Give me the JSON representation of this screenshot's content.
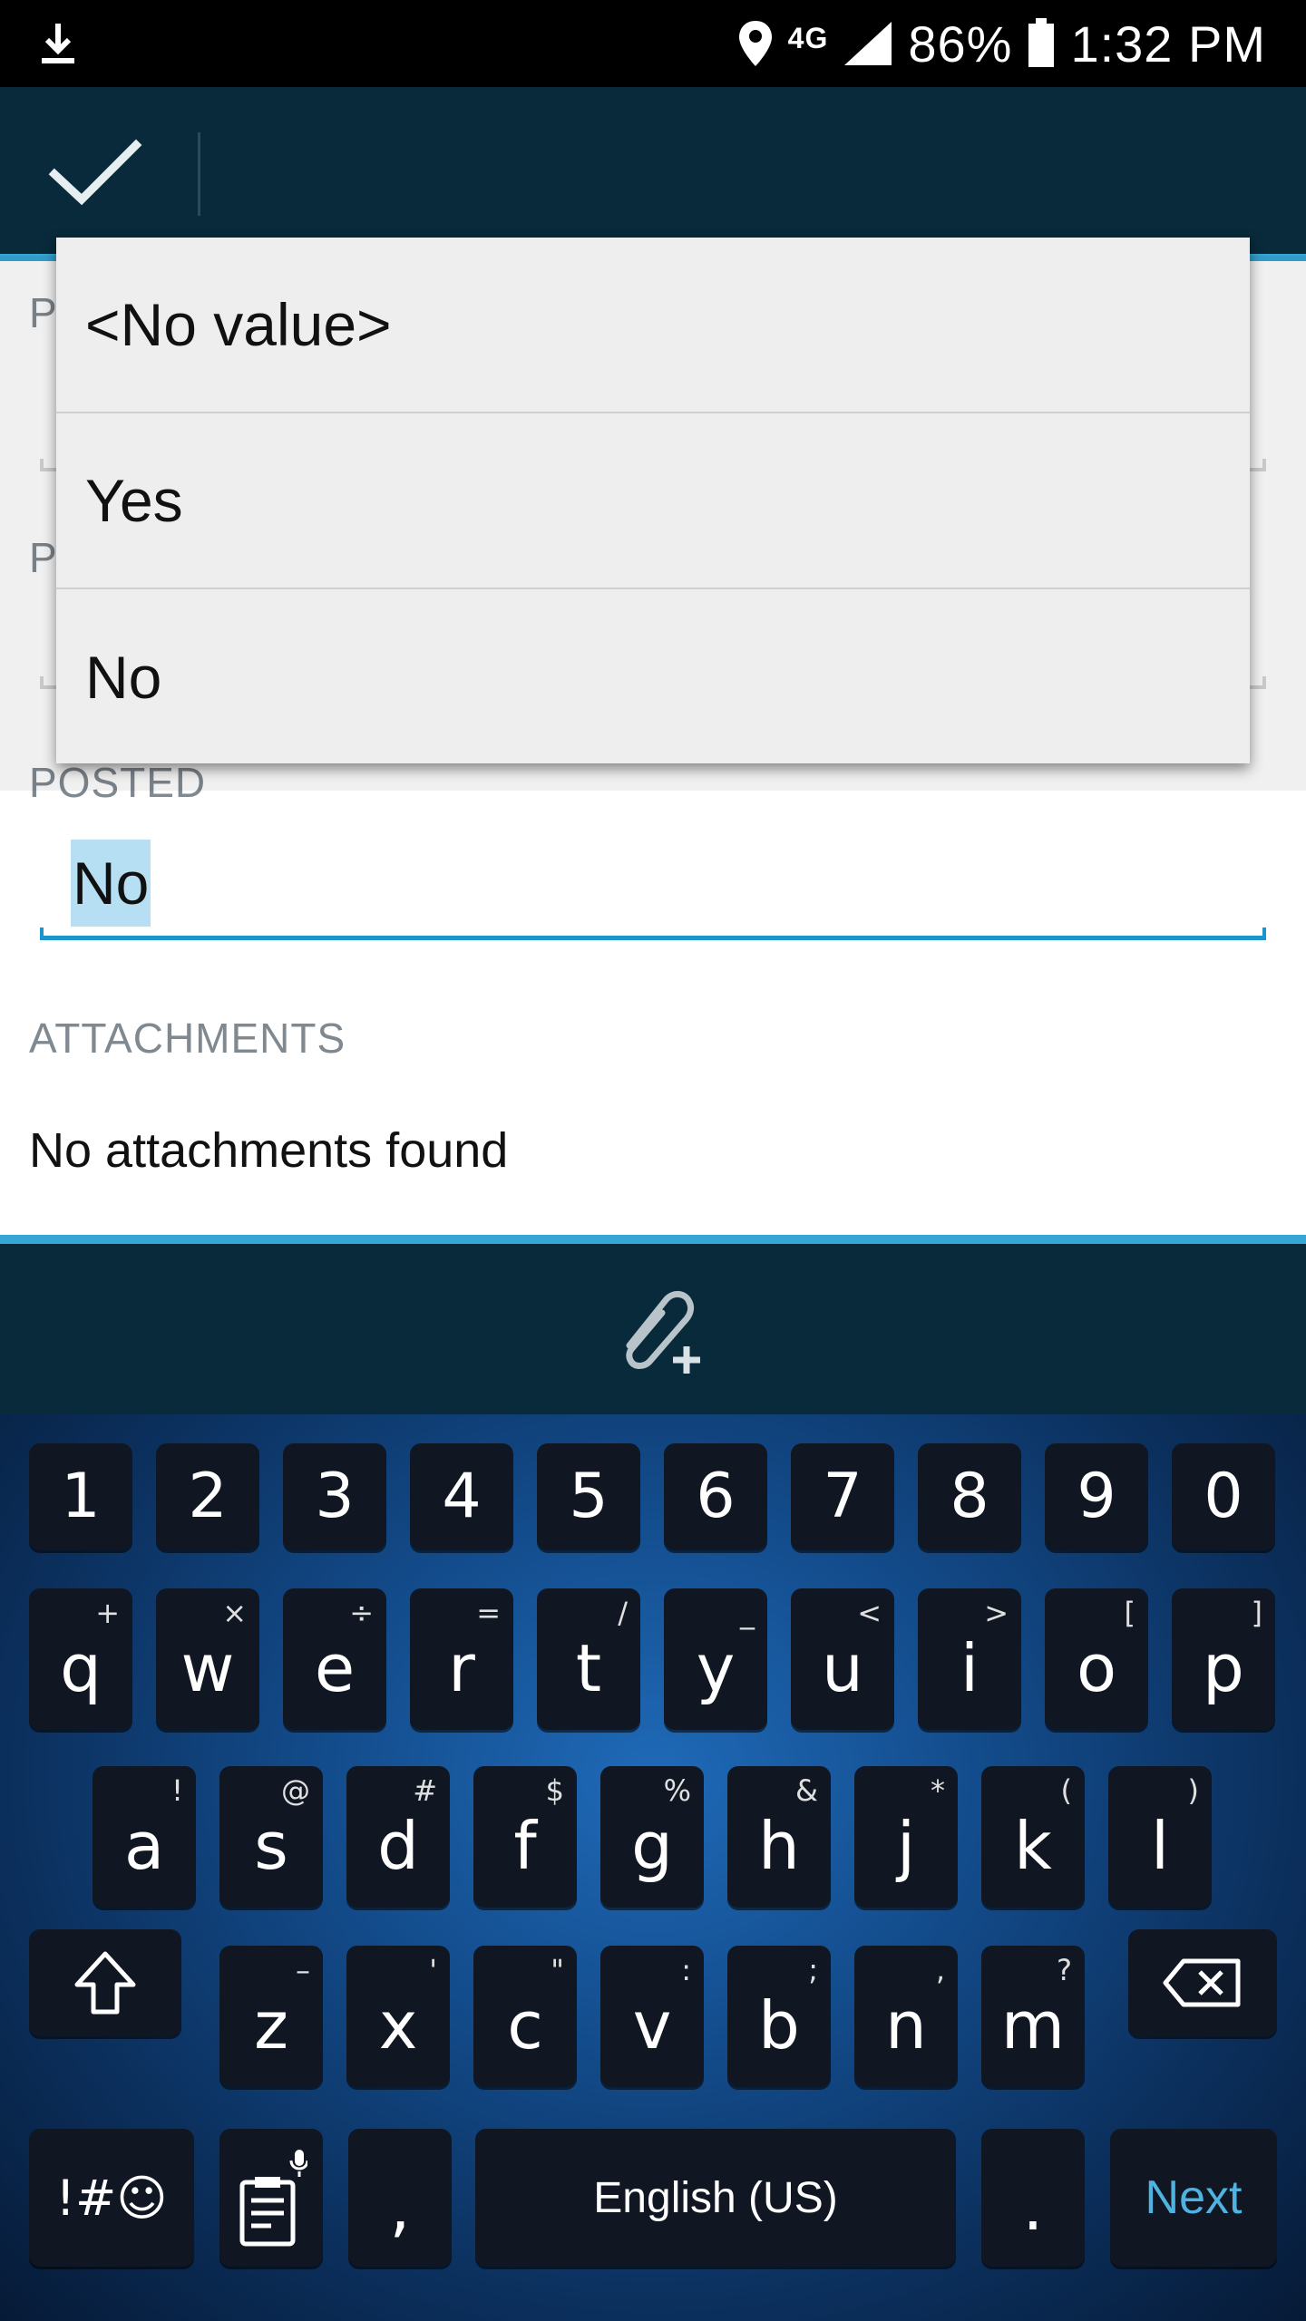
{
  "status_bar": {
    "network": "4G",
    "battery": "86%",
    "time": "1:32 PM"
  },
  "form": {
    "field1_label": "P",
    "field2_label": "P",
    "posted_label": "POSTED",
    "posted_value": "No",
    "attachments_label": "ATTACHMENTS",
    "attachments_empty": "No attachments found"
  },
  "dropdown": {
    "options": [
      "<No value>",
      "Yes",
      "No"
    ]
  },
  "keyboard": {
    "number_row": [
      "1",
      "2",
      "3",
      "4",
      "5",
      "6",
      "7",
      "8",
      "9",
      "0"
    ],
    "row1": [
      {
        "key": "q",
        "alt": "+"
      },
      {
        "key": "w",
        "alt": "×"
      },
      {
        "key": "e",
        "alt": "÷"
      },
      {
        "key": "r",
        "alt": "="
      },
      {
        "key": "t",
        "alt": "/"
      },
      {
        "key": "y",
        "alt": "_"
      },
      {
        "key": "u",
        "alt": "<"
      },
      {
        "key": "i",
        "alt": ">"
      },
      {
        "key": "o",
        "alt": "["
      },
      {
        "key": "p",
        "alt": "]"
      }
    ],
    "row2": [
      {
        "key": "a",
        "alt": "!"
      },
      {
        "key": "s",
        "alt": "@"
      },
      {
        "key": "d",
        "alt": "#"
      },
      {
        "key": "f",
        "alt": "$"
      },
      {
        "key": "g",
        "alt": "%"
      },
      {
        "key": "h",
        "alt": "&"
      },
      {
        "key": "j",
        "alt": "*"
      },
      {
        "key": "k",
        "alt": "("
      },
      {
        "key": "l",
        "alt": ")"
      }
    ],
    "row3": [
      {
        "key": "z",
        "alt": "–"
      },
      {
        "key": "x",
        "alt": "'"
      },
      {
        "key": "c",
        "alt": "\""
      },
      {
        "key": "v",
        "alt": ":"
      },
      {
        "key": "b",
        "alt": ";"
      },
      {
        "key": "n",
        "alt": ","
      },
      {
        "key": "m",
        "alt": "?"
      }
    ],
    "symbols_label": "!#☺",
    "comma": ",",
    "space_label": "English (US)",
    "period": ".",
    "next_label": "Next"
  },
  "colors": {
    "app_bar": "#082a3a",
    "accent": "#36a6d6",
    "selection": "#b6dff4",
    "next_key_text": "#4fb2e0"
  },
  "icons": {
    "status": [
      "download-icon",
      "location-icon",
      "signal-icon",
      "battery-icon"
    ],
    "app_bar": [
      "check-icon"
    ],
    "bottom_bar": [
      "attach-add-icon"
    ],
    "keyboard": [
      "shift-icon",
      "backspace-icon",
      "clipboard-mic-icon"
    ]
  }
}
